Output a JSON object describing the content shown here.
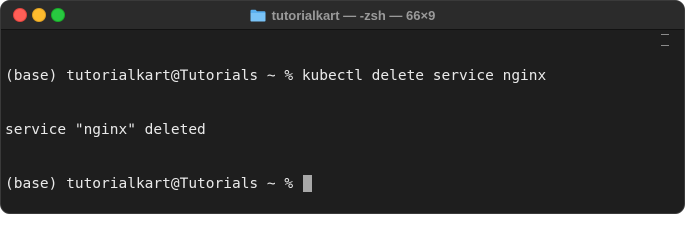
{
  "window": {
    "title": "tutorialkart — -zsh — 66×9",
    "title_icon": "folder-icon"
  },
  "terminal": {
    "lines": [
      {
        "prompt": "(base) tutorialkart@Tutorials ~ % ",
        "text": "kubectl delete service nginx"
      },
      {
        "prompt": "",
        "text": "service \"nginx\" deleted"
      },
      {
        "prompt": "(base) tutorialkart@Tutorials ~ % ",
        "text": ""
      }
    ]
  },
  "colors": {
    "background": "#1e1e1e",
    "titlebar": "#2b2b2b",
    "text": "#e9e9e9",
    "close": "#ff5f57",
    "minimize": "#febc2e",
    "zoom": "#28c840",
    "folder": "#5ab0f0"
  }
}
